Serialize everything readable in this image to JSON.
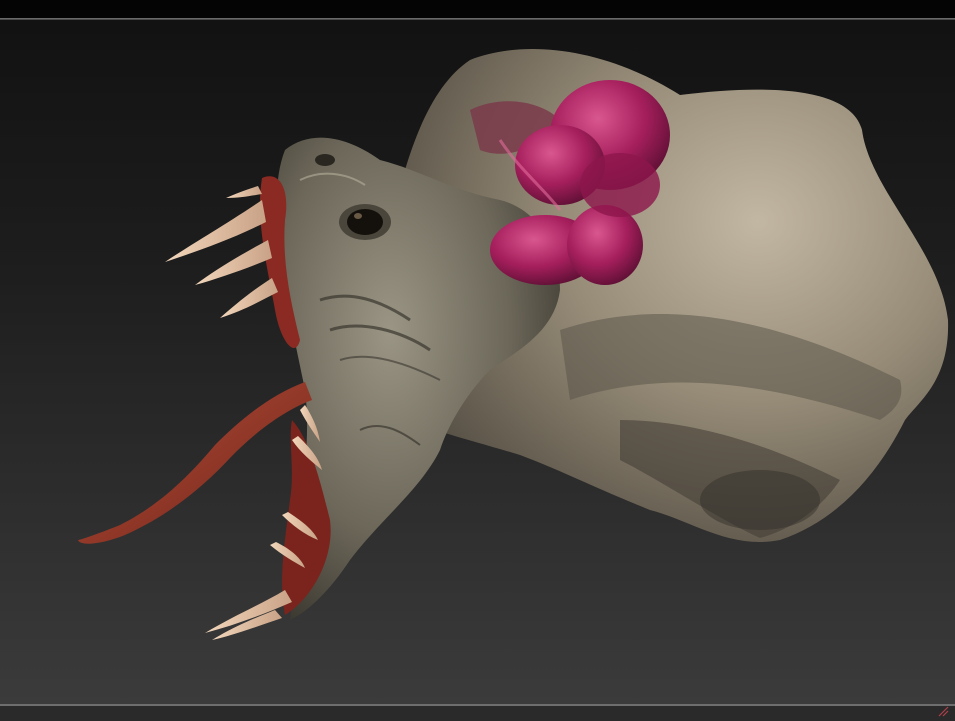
{
  "app": {
    "window_type": "3D sculpt viewport",
    "background_color_top": "#121212",
    "background_color_bottom": "#3b3b3b"
  },
  "viewport": {
    "subject": "creature-head-model",
    "colors": {
      "skin": "#8f8471",
      "skin_dark": "#4f4a41",
      "skin_light": "#b9ad97",
      "organ": "#a01f5c",
      "organ_highlight": "#d24b83",
      "gum": "#8a2a22",
      "tongue": "#9b3a2a",
      "teeth": "#e8c7a8"
    }
  },
  "icons": {
    "corner_mark": "corner-resize-icon"
  }
}
